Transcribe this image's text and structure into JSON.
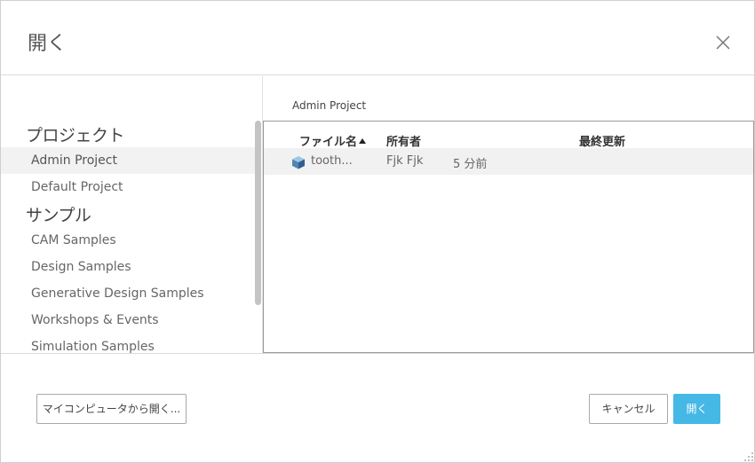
{
  "dialog": {
    "title": "開く",
    "close_icon": "close-icon"
  },
  "sidebar": {
    "groups": [
      {
        "heading": "プロジェクト",
        "items": [
          {
            "label": "Admin Project",
            "selected": true
          },
          {
            "label": "Default Project",
            "selected": false
          }
        ]
      },
      {
        "heading": "サンプル",
        "items": [
          {
            "label": "CAM Samples"
          },
          {
            "label": "Design Samples"
          },
          {
            "label": "Generative Design Samples"
          },
          {
            "label": "Workshops & Events"
          },
          {
            "label": "Simulation Samples"
          }
        ]
      }
    ]
  },
  "content": {
    "path": "Admin Project",
    "columns": {
      "name": "ファイル名",
      "owner": "所有者",
      "modified": "最終更新"
    },
    "sort": {
      "column": "name",
      "direction": "ascending"
    },
    "files": [
      {
        "name": "tooth...",
        "owner": "Fjk Fjk",
        "modified": "5 分前",
        "icon": "3d-cube-icon"
      }
    ]
  },
  "footer": {
    "open_from_computer_label": "マイコンピュータから開く...",
    "cancel_label": "キャンセル",
    "open_label": "開く"
  },
  "colors": {
    "primary": "#45b8e6",
    "selected_row": "#f1f1f1"
  }
}
